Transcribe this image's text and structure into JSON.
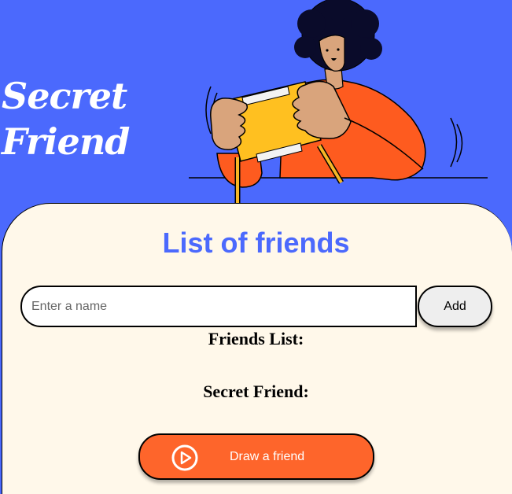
{
  "header": {
    "title_line1": "Secret",
    "title_line2": "Friend"
  },
  "main": {
    "heading": "List of friends",
    "name_input": {
      "placeholder": "Enter a name",
      "value": ""
    },
    "add_button": "Add",
    "friends_list_label": "Friends List:",
    "secret_friend_label": "Secret Friend:",
    "draw_button": {
      "label": "Draw a friend",
      "icon": "play-circle-icon"
    }
  },
  "colors": {
    "background": "#4B69FD",
    "card": "#FFF8EA",
    "accent": "#FE652B",
    "heading": "#4B69FD"
  }
}
